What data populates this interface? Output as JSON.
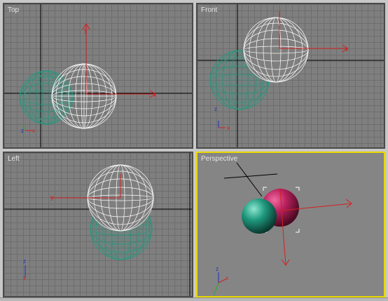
{
  "viewports": {
    "top": {
      "label": "Top"
    },
    "front": {
      "label": "Front"
    },
    "left": {
      "label": "Left"
    },
    "perspective": {
      "label": "Perspective"
    }
  },
  "axes": {
    "x": "x",
    "y": "y",
    "z": "z"
  },
  "colors": {
    "viewport_bg": "#7f7f7f",
    "grid": "#6e6e6e",
    "active_border": "#e8d800",
    "teal_sphere": "#1f9a7f",
    "white_sphere": "#ffffff",
    "magenta_sphere": "#b8205e",
    "gizmo": "#d42020"
  }
}
